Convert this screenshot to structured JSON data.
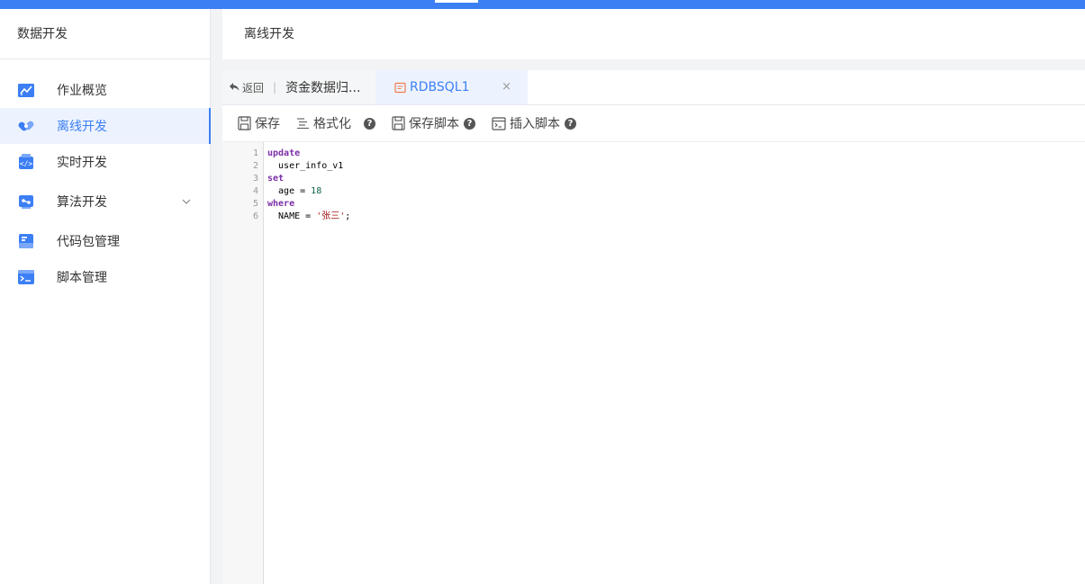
{
  "sidebar": {
    "title": "数据开发",
    "items": [
      {
        "label": "作业概览",
        "icon": "chart-icon",
        "active": false
      },
      {
        "label": "离线开发",
        "icon": "link-icon",
        "active": true
      },
      {
        "label": "实时开发",
        "icon": "code-icon",
        "active": false
      },
      {
        "label": "算法开发",
        "icon": "algorithm-icon",
        "active": false,
        "expandable": true
      },
      {
        "label": "代码包管理",
        "icon": "package-icon",
        "active": false
      },
      {
        "label": "脚本管理",
        "icon": "terminal-icon",
        "active": false
      }
    ]
  },
  "header": {
    "title": "离线开发"
  },
  "tabbar": {
    "back_label": "返回",
    "separator": "|",
    "breadcrumb": "资金数据归...",
    "tab_label": "RDBSQL1",
    "close_glyph": "×"
  },
  "toolbar": {
    "save": "保存",
    "format": "格式化",
    "save_script": "保存脚本",
    "insert_script": "插入脚本",
    "help_glyph": "?"
  },
  "editor": {
    "line_numbers": [
      "1",
      "2",
      "3",
      "4",
      "5",
      "6"
    ],
    "lines": [
      {
        "kw": "update"
      },
      {
        "text": "  user_info_v1"
      },
      {
        "kw": "set"
      },
      {
        "text": "  age = ",
        "num": "18"
      },
      {
        "kw": "where"
      },
      {
        "text": "  NAME = ",
        "str": "'张三'",
        "tail": ";"
      }
    ]
  },
  "colors": {
    "accent": "#3c7ff5",
    "keyword": "#7b2ea8",
    "number": "#116644",
    "string": "#a31515",
    "tab_icon": "#f07b4f"
  }
}
